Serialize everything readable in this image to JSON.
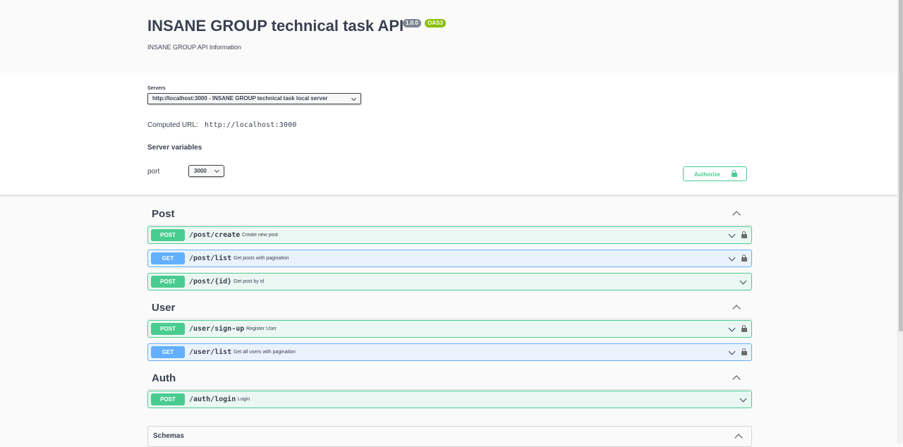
{
  "info": {
    "title": "INSANE GROUP technical task API",
    "version": "1.0.0",
    "oas": "OAS3",
    "description": "INSANE GROUP API Information"
  },
  "servers": {
    "label": "Servers",
    "selected": "http://localhost:3000 - INSANE GROUP technical task local server",
    "computed_label": "Computed URL:",
    "computed_value": "http://localhost:3000",
    "variables_title": "Server variables",
    "port_label": "port",
    "port_value": "3000"
  },
  "authorize_label": "Authorize",
  "tags": [
    {
      "name": "Post",
      "operations": [
        {
          "method": "POST",
          "path": "/post/create",
          "summary": "Create new post",
          "locked": true
        },
        {
          "method": "GET",
          "path": "/post/list",
          "summary": "Get posts with pagination",
          "locked": true
        },
        {
          "method": "POST",
          "path": "/post/{id}",
          "summary": "Get post by id",
          "locked": false
        }
      ]
    },
    {
      "name": "User",
      "operations": [
        {
          "method": "POST",
          "path": "/user/sign-up",
          "summary": "Register User",
          "locked": true
        },
        {
          "method": "GET",
          "path": "/user/list",
          "summary": "Get all users with pagination",
          "locked": true
        }
      ]
    },
    {
      "name": "Auth",
      "operations": [
        {
          "method": "POST",
          "path": "/auth/login",
          "summary": "Login",
          "locked": false
        }
      ]
    }
  ],
  "schemas_label": "Schemas",
  "colors": {
    "post": "#49cc90",
    "get": "#61affe",
    "text": "#3b4151"
  }
}
